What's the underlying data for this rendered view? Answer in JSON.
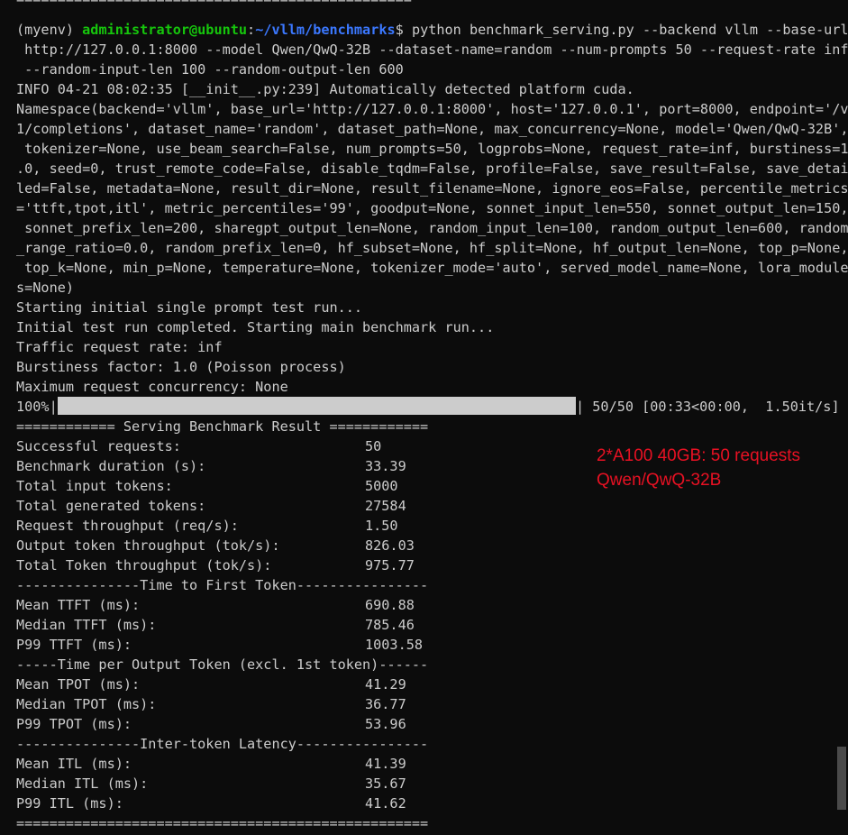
{
  "terminal": {
    "top_rule": "================================================",
    "prompt": {
      "env": "(myenv) ",
      "user_host": "administrator@ubuntu",
      "colon": ":",
      "path": "~/vllm/benchmarks",
      "dollar": "$ ",
      "command_line1": "python benchmark_serving.py --backend vllm --base-url",
      "command_line2": " http://127.0.0.1:8000 --model Qwen/QwQ-32B --dataset-name=random --num-prompts 50 --request-rate inf",
      "command_line3": " --random-input-len 100 --random-output-len 600"
    },
    "info_line": "INFO 04-21 08:02:35 [__init__.py:239] Automatically detected platform cuda.",
    "namespace_lines": [
      "Namespace(backend='vllm', base_url='http://127.0.0.1:8000', host='127.0.0.1', port=8000, endpoint='/v",
      "1/completions', dataset_name='random', dataset_path=None, max_concurrency=None, model='Qwen/QwQ-32B',",
      " tokenizer=None, use_beam_search=False, num_prompts=50, logprobs=None, request_rate=inf, burstiness=1",
      ".0, seed=0, trust_remote_code=False, disable_tqdm=False, profile=False, save_result=False, save_detai",
      "led=False, metadata=None, result_dir=None, result_filename=None, ignore_eos=False, percentile_metrics",
      "='ttft,tpot,itl', metric_percentiles='99', goodput=None, sonnet_input_len=550, sonnet_output_len=150,",
      " sonnet_prefix_len=200, sharegpt_output_len=None, random_input_len=100, random_output_len=600, random",
      "_range_ratio=0.0, random_prefix_len=0, hf_subset=None, hf_split=None, hf_output_len=None, top_p=None,",
      " top_k=None, min_p=None, temperature=None, tokenizer_mode='auto', served_model_name=None, lora_module",
      "s=None)"
    ],
    "status_lines": [
      "Starting initial single prompt test run...",
      "Initial test run completed. Starting main benchmark run...",
      "Traffic request rate: inf",
      "Burstiness factor: 1.0 (Poisson process)",
      "Maximum request concurrency: None"
    ],
    "progress": {
      "percent_label": "100%|",
      "fraction": 1.0,
      "suffix": "| 50/50 [00:33<00:00,  1.50it/s]"
    },
    "result_header": "============ Serving Benchmark Result ============",
    "metrics": [
      {
        "label": "Successful requests:",
        "value": "50"
      },
      {
        "label": "Benchmark duration (s):",
        "value": "33.39"
      },
      {
        "label": "Total input tokens:",
        "value": "5000"
      },
      {
        "label": "Total generated tokens:",
        "value": "27584"
      },
      {
        "label": "Request throughput (req/s):",
        "value": "1.50"
      },
      {
        "label": "Output token throughput (tok/s):",
        "value": "826.03"
      },
      {
        "label": "Total Token throughput (tok/s):",
        "value": "975.77"
      }
    ],
    "ttft_header": "---------------Time to First Token----------------",
    "ttft": [
      {
        "label": "Mean TTFT (ms):",
        "value": "690.88"
      },
      {
        "label": "Median TTFT (ms):",
        "value": "785.46"
      },
      {
        "label": "P99 TTFT (ms):",
        "value": "1003.58"
      }
    ],
    "tpot_header": "-----Time per Output Token (excl. 1st token)------",
    "tpot": [
      {
        "label": "Mean TPOT (ms):",
        "value": "41.29"
      },
      {
        "label": "Median TPOT (ms):",
        "value": "36.77"
      },
      {
        "label": "P99 TPOT (ms):",
        "value": "53.96"
      }
    ],
    "itl_header": "---------------Inter-token Latency----------------",
    "itl": [
      {
        "label": "Mean ITL (ms):",
        "value": "41.39"
      },
      {
        "label": "Median ITL (ms):",
        "value": "35.67"
      },
      {
        "label": "P99 ITL (ms):",
        "value": "41.62"
      }
    ],
    "bottom_rule": "=================================================="
  },
  "annotation": {
    "line1": "2*A100 40GB: 50 requests",
    "line2": "Qwen/QwQ-32B"
  },
  "colors": {
    "background": "#0c0c0c",
    "text": "#cccccc",
    "prompt_user": "#16c60c",
    "prompt_path": "#3b78ff",
    "annotation": "#e81123"
  }
}
